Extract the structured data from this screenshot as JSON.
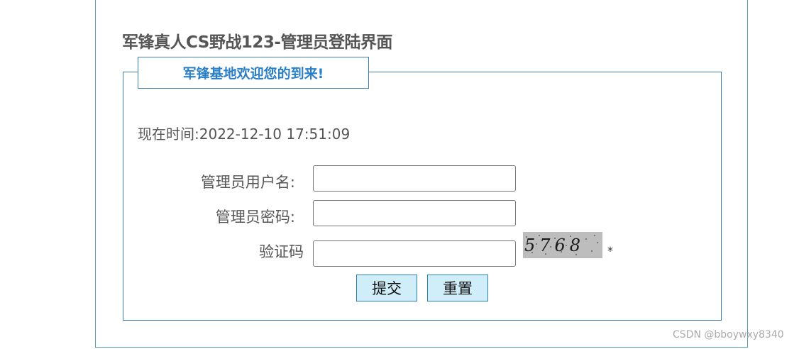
{
  "page": {
    "title": "军锋真人CS野战123-管理员登陆界面"
  },
  "form": {
    "legend": "军锋基地欢迎您的到来!",
    "time_label": "现在时间:",
    "time_value": "2022-12-10 17:51:09",
    "username_label": "管理员用户名:",
    "username_value": "",
    "password_label": "管理员密码:",
    "password_value": "",
    "captcha_label": "验证码",
    "captcha_value": "",
    "captcha_image_text": "5768",
    "required_mark": "*",
    "submit_label": "提交",
    "reset_label": "重置"
  },
  "watermark": "CSDN @bboywxy8340",
  "colors": {
    "accent_blue": "#2a7fc9",
    "border_blue": "#3a7fb0",
    "button_bg": "#cfeefa",
    "text_gray": "#555555"
  }
}
